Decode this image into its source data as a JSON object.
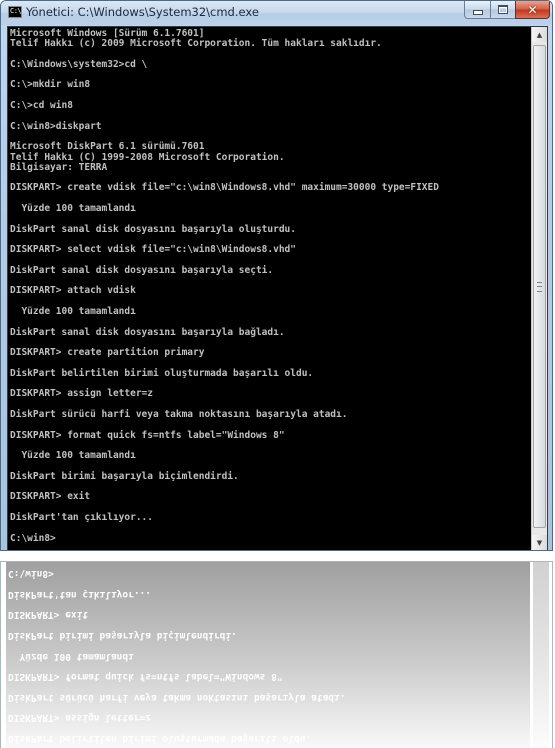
{
  "window": {
    "title": "Yönetici: C:\\Windows\\System32\\cmd.exe",
    "icon_text": "C:\\",
    "buttons": {
      "minimize": "minimize-icon",
      "maximize": "maximize-icon",
      "close": "close-icon"
    }
  },
  "console": {
    "lines": [
      "Microsoft Windows [Sürüm 6.1.7601]",
      "Telif Hakkı (c) 2009 Microsoft Corporation. Tüm hakları saklıdır.",
      "",
      "C:\\Windows\\system32>cd \\",
      "",
      "C:\\>mkdir win8",
      "",
      "C:\\>cd win8",
      "",
      "C:\\win8>diskpart",
      "",
      "Microsoft DiskPart 6.1 sürümü.7601",
      "Telif Hakkı (C) 1999-2008 Microsoft Corporation.",
      "Bilgisayar: TERRA",
      "",
      "DISKPART> create vdisk file=\"c:\\win8\\Windows8.vhd\" maximum=30000 type=FIXED",
      "",
      "  Yüzde 100 tamamlandı",
      "",
      "DiskPart sanal disk dosyasını başarıyla oluşturdu.",
      "",
      "DISKPART> select vdisk file=\"c:\\win8\\Windows8.vhd\"",
      "",
      "DiskPart sanal disk dosyasını başarıyla seçti.",
      "",
      "DISKPART> attach vdisk",
      "",
      "  Yüzde 100 tamamlandı",
      "",
      "DiskPart sanal disk dosyasını başarıyla bağladı.",
      "",
      "DISKPART> create partition primary",
      "",
      "DiskPart belirtilen birimi oluşturmada başarılı oldu.",
      "",
      "DISKPART> assign letter=z",
      "",
      "DiskPart sürücü harfi veya takma noktasını başarıyla atadı.",
      "",
      "DISKPART> format quick fs=ntfs label=\"Windows 8\"",
      "",
      "  Yüzde 100 tamamlandı",
      "",
      "DiskPart birimi başarıyla biçimlendirdi.",
      "",
      "DISKPART> exit",
      "",
      "DiskPart'tan çıkılıyor...",
      "",
      "C:\\win8>"
    ]
  },
  "scrollbar": {
    "up_icon": "scroll-up-arrow-icon",
    "down_icon": "scroll-down-arrow-icon",
    "position": 1.0
  },
  "colors": {
    "console_bg": "#000000",
    "console_text": "#c0c0c0",
    "close_button": "#c2391f"
  }
}
